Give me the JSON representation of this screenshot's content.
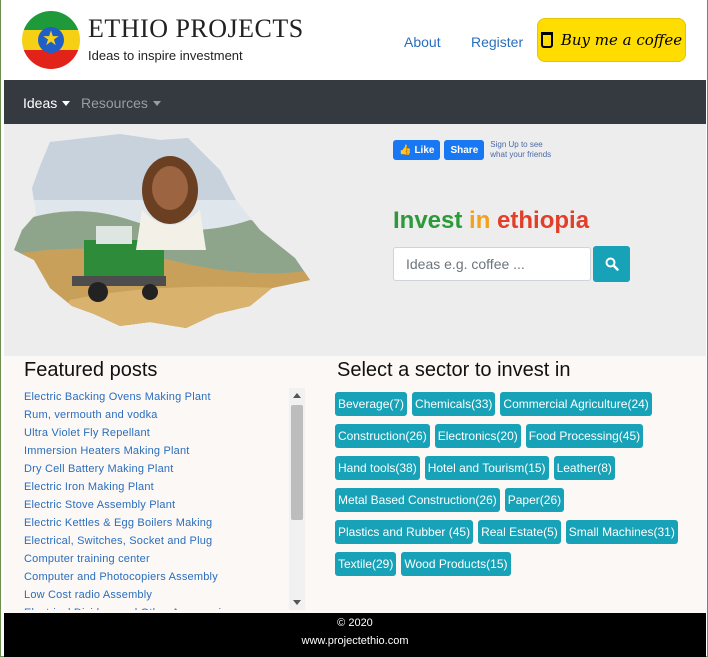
{
  "brand": {
    "title": "ETHIO PROJECTS",
    "tagline": "Ideas to inspire investment"
  },
  "header": {
    "about": "About",
    "register": "Register",
    "coffee_label": "Buy me a coffee"
  },
  "navbar": {
    "ideas": "Ideas",
    "resources": "Resources"
  },
  "hero": {
    "fb_like": "Like",
    "fb_share": "Share",
    "fb_signup_line1": "Sign Up to see",
    "fb_signup_line2": "what your friends",
    "headline_part1": "Invest",
    "headline_part2": "in",
    "headline_part3": "ethiopia",
    "search_placeholder": "Ideas e.g. coffee ..."
  },
  "featured": {
    "title": "Featured posts",
    "items": [
      "Electric Backing Ovens Making Plant",
      "Rum, vermouth and vodka",
      "Ultra Violet Fly Repellant",
      "Immersion Heaters Making Plant",
      "Dry Cell Battery Making Plant",
      "Electric Iron Making Plant",
      "Electric Stove Assembly Plant",
      "Electric Kettles & Egg Boilers Making",
      "Electrical, Switches, Socket and Plug",
      "Computer training center",
      "Computer and Photocopiers Assembly",
      "Low Cost radio Assembly",
      "Electrical Dividers and Other Accessories"
    ]
  },
  "sectors": {
    "title": "Select a sector to invest in",
    "rows": [
      [
        "Beverage(7)",
        "Chemicals(33)",
        "Commercial Agriculture(24)"
      ],
      [
        "Construction(26)",
        "Electronics(20)",
        "Food Processing(45)"
      ],
      [
        "Hand tools(38)",
        "Hotel and Tourism(15)",
        "Leather(8)"
      ],
      [
        "Metal Based Construction(26)",
        "Paper(26)"
      ],
      [
        "Plastics and Rubber (45)",
        "Real Estate(5)",
        "Small Machines(31)"
      ],
      [
        "Textile(29)",
        "Wood Products(15)"
      ]
    ]
  },
  "footer": {
    "copyright": "© 2020",
    "site": "www.projectethio.com"
  },
  "colors": {
    "accent": "#17a2b8",
    "navbar": "#343a40",
    "coffee": "#ffdd00",
    "link": "#2a6ebd"
  }
}
